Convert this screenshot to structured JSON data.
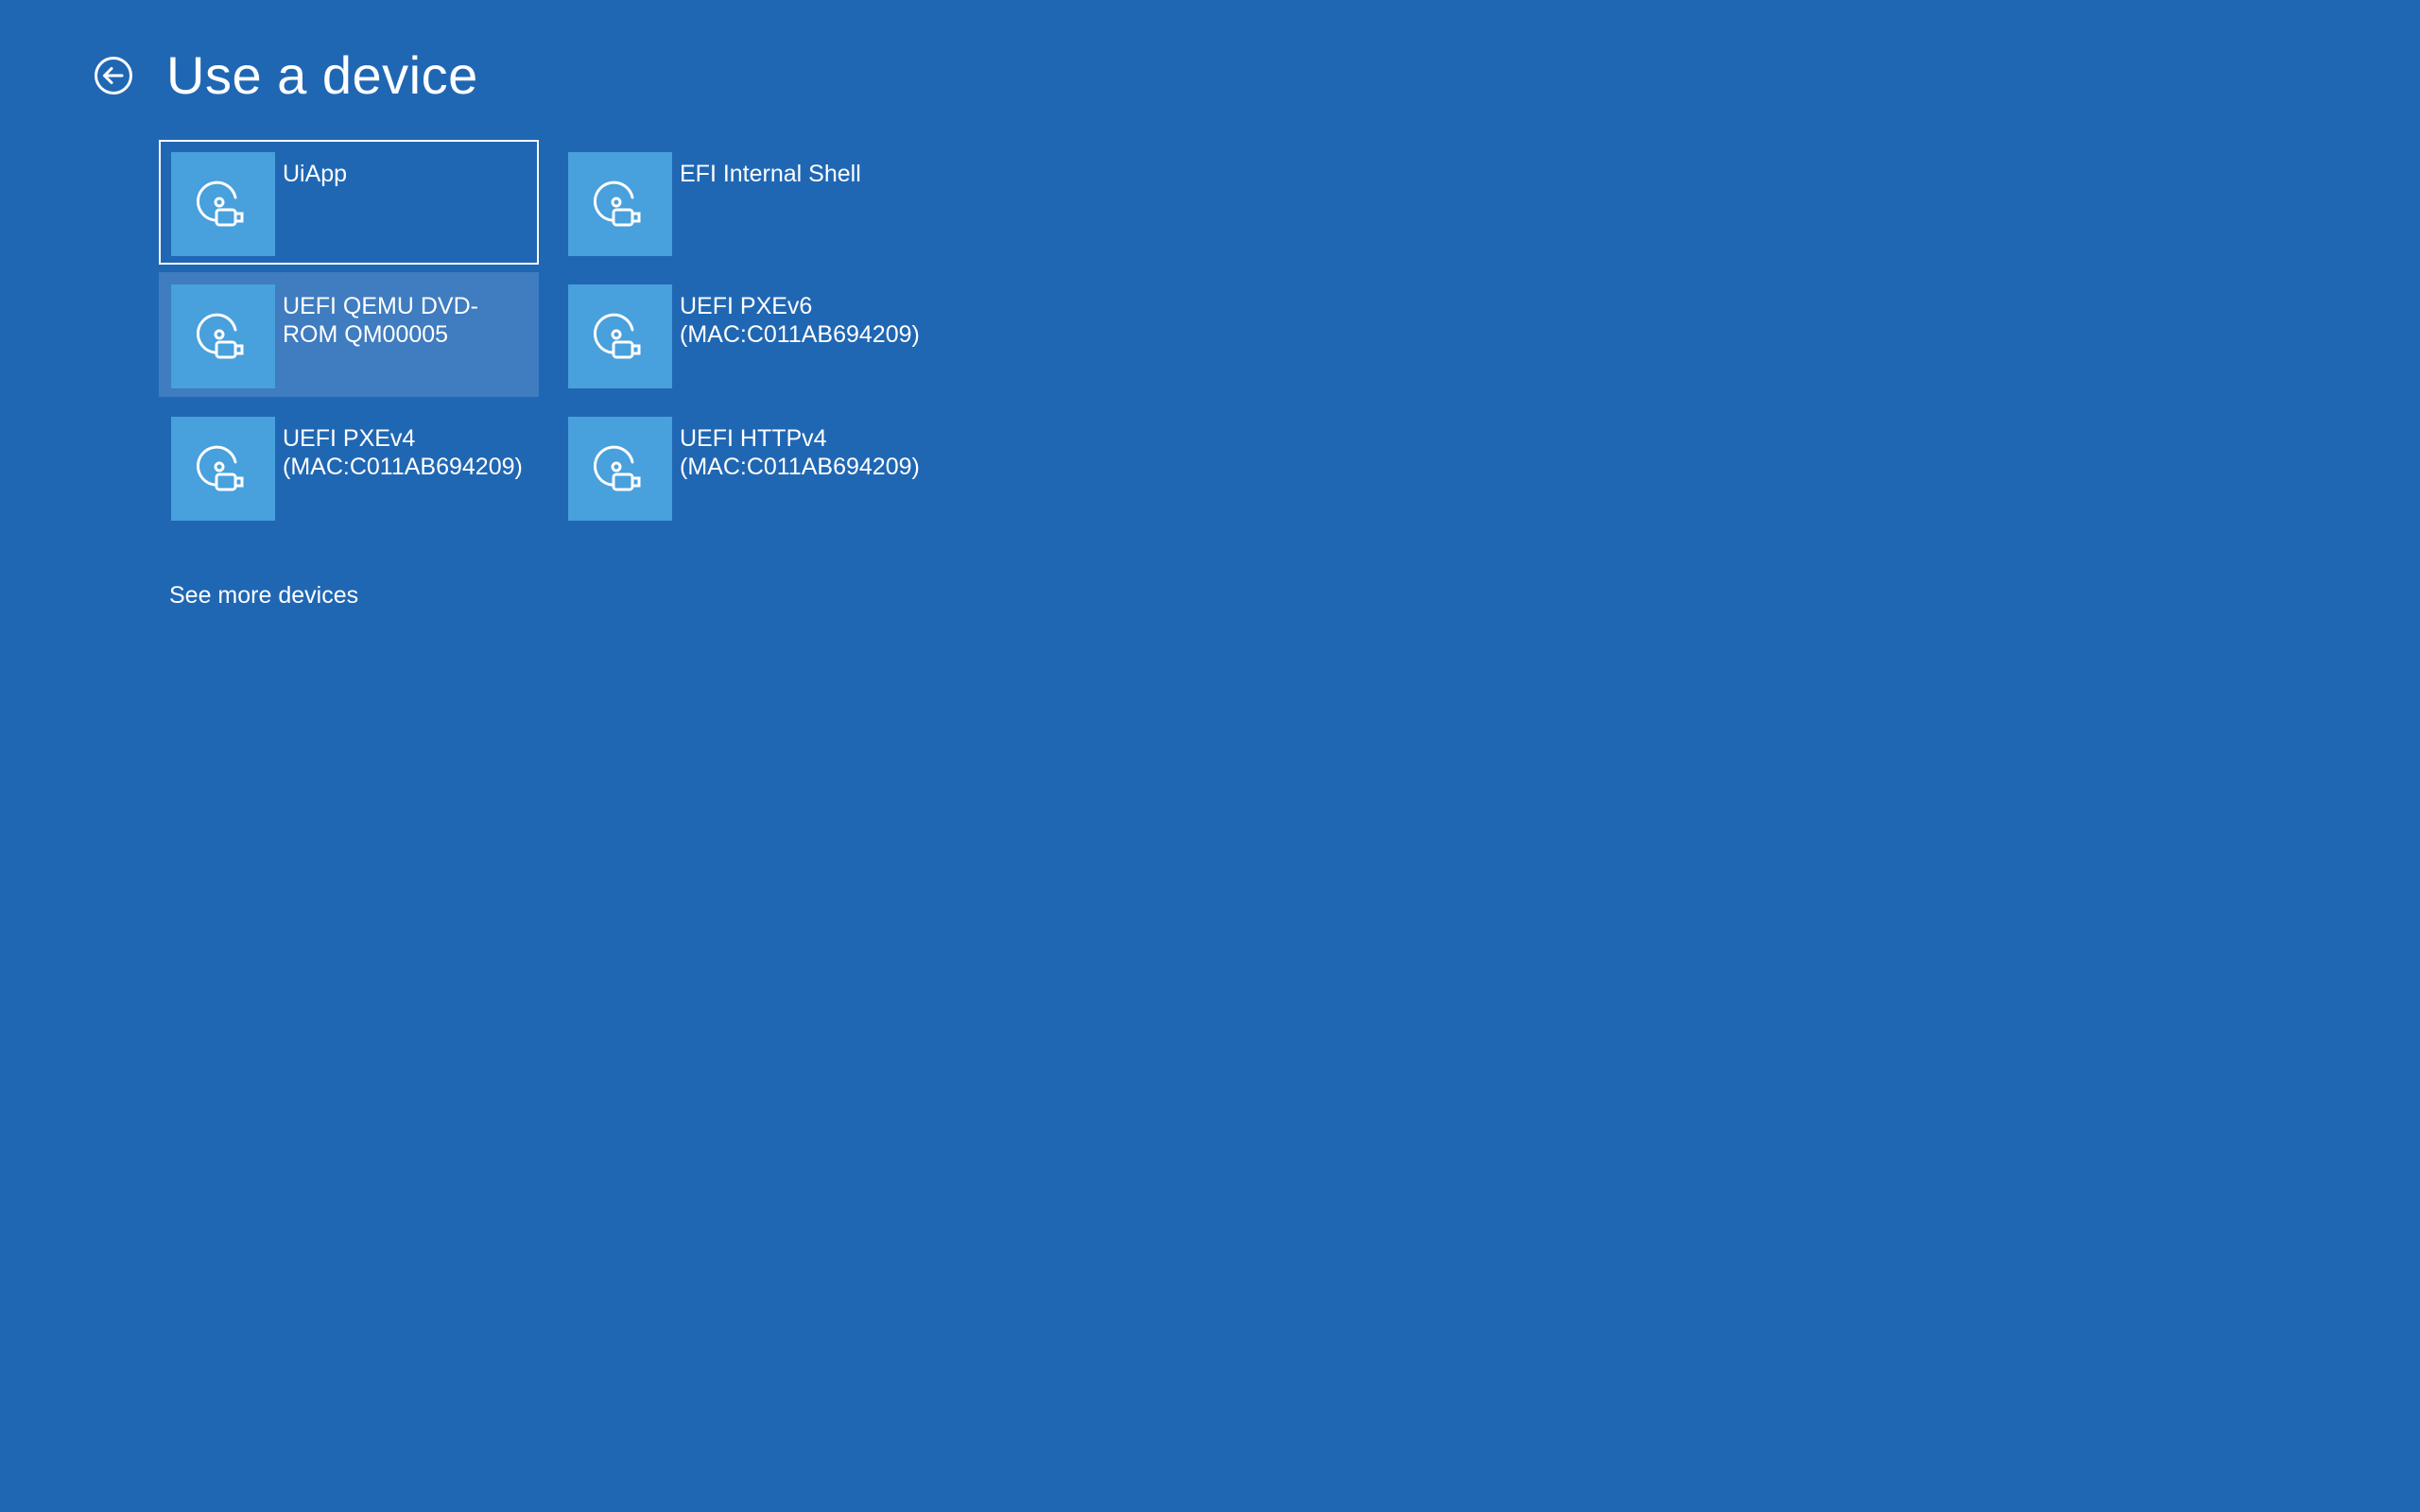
{
  "header": {
    "title": "Use a device",
    "back_icon": "arrow-left-circle-icon"
  },
  "devices": [
    {
      "label": "UiApp",
      "icon": "device-disc-icon",
      "state": "focused"
    },
    {
      "label": "EFI Internal Shell",
      "icon": "device-disc-icon",
      "state": "normal"
    },
    {
      "label": "UEFI QEMU DVD-\nROM QM00005",
      "icon": "device-disc-icon",
      "state": "hovered"
    },
    {
      "label": "UEFI PXEv6\n(MAC:C011AB694209)",
      "icon": "device-disc-icon",
      "state": "normal"
    },
    {
      "label": "UEFI PXEv4\n(MAC:C011AB694209)",
      "icon": "device-disc-icon",
      "state": "normal"
    },
    {
      "label": "UEFI HTTPv4\n(MAC:C011AB694209)",
      "icon": "device-disc-icon",
      "state": "normal"
    }
  ],
  "more_link": "See more devices",
  "colors": {
    "background": "#2067b3",
    "tile_icon_bg": "#48a0dc",
    "tile_hover_bg": "#3f7cc0",
    "text": "#ffffff"
  }
}
